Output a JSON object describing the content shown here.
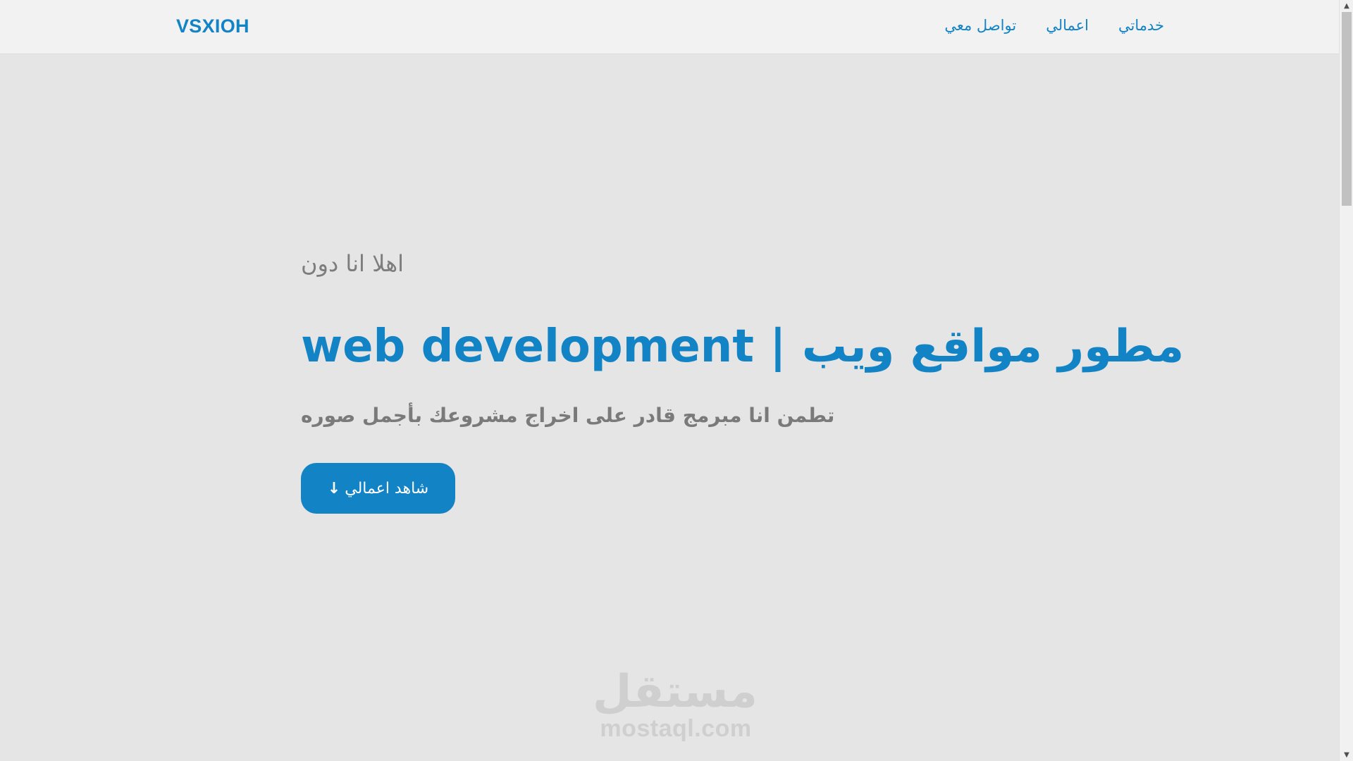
{
  "navbar": {
    "brand": "VSXIOH",
    "links": [
      "خدماتي",
      "اعمالي",
      "تواصل معي"
    ]
  },
  "hero": {
    "greeting": "اهلا انا دون",
    "headline": "مطور مواقع ويب | web development",
    "subtitle": "تطمن انا مبرمج قادر على اخراج مشروعك بأجمل صوره",
    "cta_label": "شاهد اعمالي",
    "cta_icon": "arrow-down-icon"
  },
  "watermark": {
    "arabic": "مستقل",
    "latin": "mostaql.com"
  },
  "colors": {
    "accent": "#1283c5",
    "background": "#e5e5e5",
    "navbar": "#f2f2f2",
    "muted_text": "#7d7d7d"
  }
}
